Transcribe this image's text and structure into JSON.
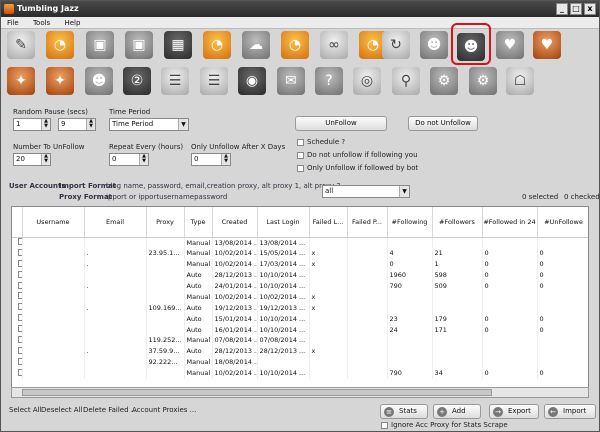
{
  "window": {
    "title": "Tumbling Jazz",
    "min": "_",
    "max": "□",
    "close": "x"
  },
  "menu": [
    "File",
    "Tools",
    "Help"
  ],
  "settings": {
    "random_pause_label": "Random Pause (secs)",
    "random_pause_min": "1",
    "random_pause_max": "9",
    "time_period_label": "Time Period",
    "time_period_value": "Time Period",
    "number_to_unfollow_label": "Number To UnFollow",
    "number_to_unfollow": "20",
    "repeat_every_label": "Repeat Every (hours)",
    "repeat_every": "0",
    "only_unfollow_label": "Only Unfollow After X Days",
    "only_unfollow": "0"
  },
  "actions": {
    "unfollow": "UnFollow",
    "do_not_unfollow": "Do not Unfollow",
    "schedule": "Schedule ?",
    "no_unfollow_following": "Do not unfollow if following you",
    "only_unfollow_bot": "Only Unfollow if followed by bot"
  },
  "accounts": {
    "section_label": "User Accounts",
    "import_format_label": "Import Format",
    "import_format": "blog name, password, email,creation proxy, alt proxy 1, alt proxy 2, ...",
    "proxy_format_label": "Proxy Format",
    "proxy_format": "ipport  or  ipportusernamepassword",
    "filter_value": "all",
    "selected_count": "0 selected",
    "checked_count": "0 checked"
  },
  "table": {
    "columns": [
      "",
      "Username",
      "Email",
      "Proxy",
      "Type",
      "Created",
      "Last Login",
      "Failed L...",
      "Failed P...",
      "#Following",
      "#Followers",
      "#Followed in 24",
      "#UnFollowe"
    ],
    "rows": [
      [
        "",
        "",
        "",
        "",
        "Manual",
        "13/08/2014 ...",
        "13/08/2014 ...",
        "",
        "",
        "",
        "",
        "",
        ""
      ],
      [
        "",
        "",
        ".",
        "23.95.1...",
        "Manual",
        "10/02/2014 ...",
        "15/05/2014 ...",
        "x",
        "",
        "4",
        "21",
        "0",
        "0"
      ],
      [
        "",
        "",
        ".",
        "",
        "Manual",
        "10/02/2014 ...",
        "17/03/2014 ...",
        "x",
        "",
        "0",
        "1",
        "0",
        "0"
      ],
      [
        "",
        "",
        "",
        "",
        "Auto",
        "28/12/2013 ...",
        "10/10/2014 ...",
        "",
        "",
        "1960",
        "598",
        "0",
        "0"
      ],
      [
        "",
        "",
        ".",
        "",
        "Auto",
        "24/01/2014 ...",
        "10/10/2014 ...",
        "",
        "",
        "790",
        "509",
        "0",
        "0"
      ],
      [
        "",
        "",
        "",
        "",
        "Manual",
        "10/02/2014 ...",
        "10/02/2014 ...",
        "x",
        "",
        "",
        "",
        "",
        ""
      ],
      [
        "",
        "",
        ".",
        "109.169...",
        "Auto",
        "19/12/2013 ...",
        "19/12/2013 ...",
        "x",
        "",
        "",
        "",
        "",
        ""
      ],
      [
        "",
        "",
        "",
        "",
        "Auto",
        "15/01/2014 ...",
        "10/10/2014 ...",
        "",
        "",
        "23",
        "179",
        "0",
        "0"
      ],
      [
        "",
        "",
        "",
        "",
        "Auto",
        "16/01/2014 ...",
        "10/10/2014 ...",
        "",
        "",
        "24",
        "171",
        "0",
        "0"
      ],
      [
        "",
        "",
        "",
        "119.252...",
        "Manual",
        "07/08/2014 ...",
        "07/08/2014 ...",
        "",
        "",
        "",
        "",
        "",
        ""
      ],
      [
        "",
        "",
        ".",
        "37.59.9...",
        "Auto",
        "28/12/2013 ...",
        "28/12/2013 ...",
        "x",
        "",
        "",
        "",
        "",
        ""
      ],
      [
        "",
        "",
        "",
        "92.222...",
        "Manual",
        "18/08/2014 ...",
        "",
        "",
        "",
        "",
        "",
        "",
        ""
      ],
      [
        "",
        "",
        "",
        "",
        "Manual",
        "10/02/2014 ...",
        "10/10/2014 ...",
        "",
        "",
        "790",
        "34",
        "0",
        "0"
      ]
    ]
  },
  "footer": {
    "select_all": "Select All",
    "deselect_all": "Deselect All",
    "delete_failed": "Delete Failed ...",
    "account_proxies": "Account Proxies ...",
    "stats": "Stats",
    "add": "Add",
    "export": "Export",
    "import": "Import",
    "ignore_acc_proxy": "Ignore Acc Proxy for Stats Scrape"
  },
  "toolbar_icons": [
    "tumblr-rss-icon",
    "rss-icon",
    "photo-icon",
    "photo-rss-icon",
    "video-clapper-icon",
    "rss-icon",
    "cloud-icon",
    "rss-icon",
    "link-icon",
    "rss-icon",
    "repost-icon",
    "follow-user-icon",
    "unfollow-user-icon",
    "heart-icon",
    "heart-rss-icon",
    "tag-icon",
    "tag-rss-icon",
    "add-users-icon",
    "user-number-icon",
    "list-icon",
    "list-rss-icon",
    "feed-icon",
    "message-icon",
    "question-icon",
    "view-icon",
    "search-icon",
    "settings-icon",
    "robot-icon"
  ]
}
